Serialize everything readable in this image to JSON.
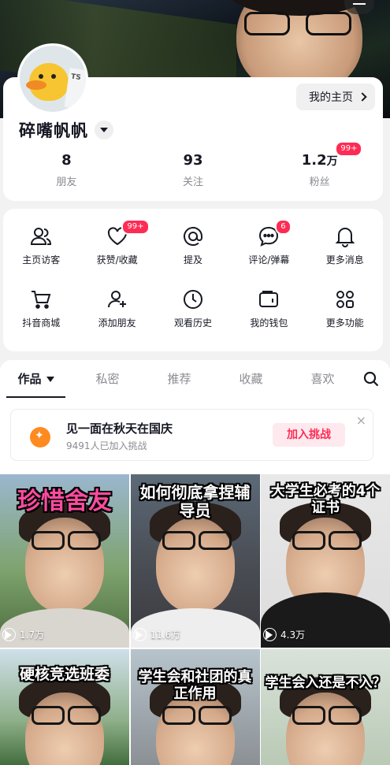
{
  "profile": {
    "nickname": "碎嘴帆帆",
    "home_button": "我的主页",
    "stats": [
      {
        "num": "8",
        "unit": "",
        "label": "朋友"
      },
      {
        "num": "93",
        "unit": "",
        "label": "关注"
      },
      {
        "num": "1.2",
        "unit": "万",
        "label": "粉丝",
        "badge": "99+"
      }
    ],
    "avatar_text": "TS"
  },
  "tools": [
    {
      "label": "主页访客",
      "icon": "visitors-icon"
    },
    {
      "label": "获赞/收藏",
      "icon": "heart-icon",
      "badge": "99+"
    },
    {
      "label": "提及",
      "icon": "at-icon"
    },
    {
      "label": "评论/弹幕",
      "icon": "comment-icon",
      "badge": "6"
    },
    {
      "label": "更多消息",
      "icon": "bell-icon"
    },
    {
      "label": "抖音商城",
      "icon": "cart-icon"
    },
    {
      "label": "添加朋友",
      "icon": "add-friend-icon"
    },
    {
      "label": "观看历史",
      "icon": "clock-icon"
    },
    {
      "label": "我的钱包",
      "icon": "wallet-icon"
    },
    {
      "label": "更多功能",
      "icon": "grid-icon"
    }
  ],
  "tabs": [
    {
      "label": "作品",
      "active": true
    },
    {
      "label": "私密"
    },
    {
      "label": "推荐"
    },
    {
      "label": "收藏"
    },
    {
      "label": "喜欢"
    }
  ],
  "challenge": {
    "title": "见一面在秋天在国庆",
    "subtitle": "9491人已加入挑战",
    "join": "加入挑战",
    "close": "×"
  },
  "videos": [
    {
      "caption": "珍惜舍友",
      "plays": "1.7万",
      "style": "pink"
    },
    {
      "caption": "如何彻底拿捏辅导员",
      "plays": "11.6万"
    },
    {
      "caption": "大学生必考的4个证书",
      "plays": "4.3万"
    },
    {
      "caption": "硬核竞选班委",
      "plays": ""
    },
    {
      "caption": "学生会和社团的真正作用",
      "plays": ""
    },
    {
      "caption": "学生会入还是不入？",
      "plays": ""
    }
  ],
  "colors": {
    "accent": "#fe2c55",
    "challenge_icon": "#ff8a1f"
  }
}
